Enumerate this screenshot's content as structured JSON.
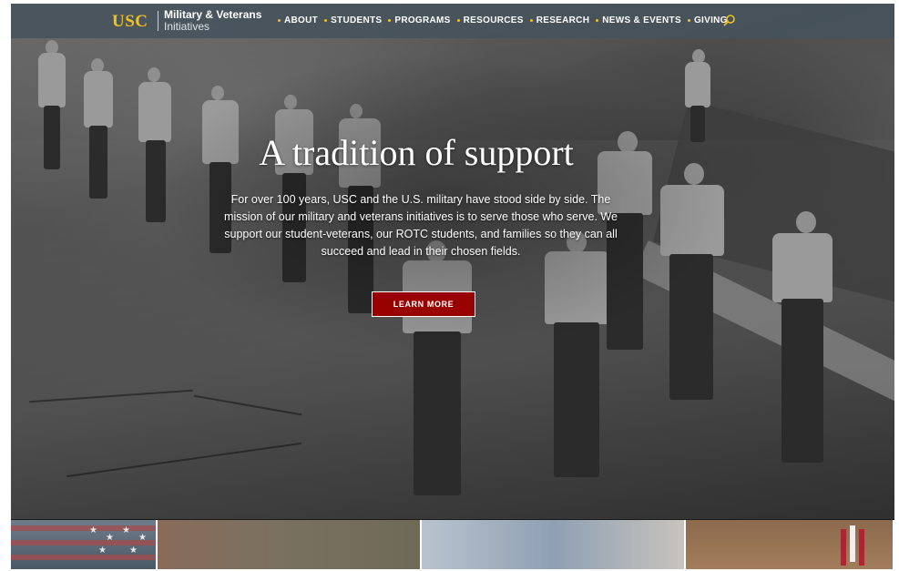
{
  "header": {
    "logo_text": "USC",
    "site_title_line1": "Military & Veterans",
    "site_title_line2": "Initiatives"
  },
  "nav": {
    "items": [
      {
        "label": "ABOUT"
      },
      {
        "label": "STUDENTS"
      },
      {
        "label": "PROGRAMS"
      },
      {
        "label": "RESOURCES"
      },
      {
        "label": "RESEARCH"
      },
      {
        "label": "NEWS & EVENTS"
      },
      {
        "label": "GIVING"
      }
    ],
    "search_icon": "search-icon"
  },
  "hero": {
    "headline": "A tradition of support",
    "intro": "For over 100 years, USC and the U.S. military have stood side by side. The mission of our military and veterans initiatives is to serve those who serve. We support our student-veterans, our ROTC students, and families so they can all succeed and lead in their chosen fields.",
    "cta_label": "LEARN MORE"
  },
  "colors": {
    "accent": "#f2c31b",
    "cta": "#990000",
    "nav_bg": "#46525c"
  }
}
